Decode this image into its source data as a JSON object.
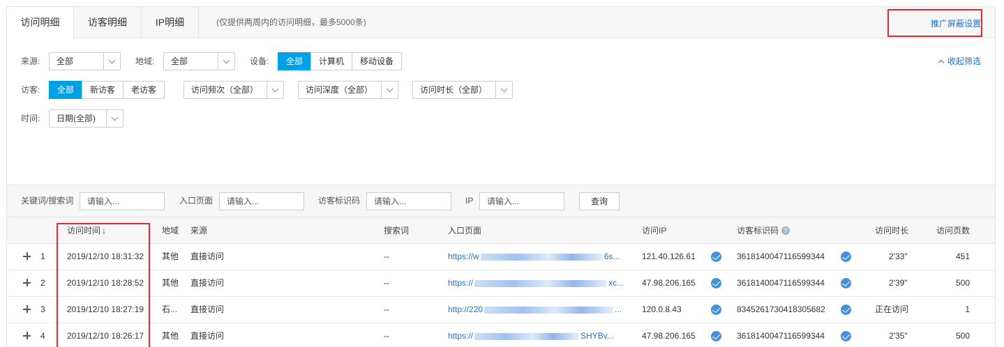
{
  "tabs": [
    {
      "label": "访问明细",
      "active": true
    },
    {
      "label": "访客明细",
      "active": false
    },
    {
      "label": "IP明细",
      "active": false
    }
  ],
  "tab_hint": "(仅提供两周内的访问明细，最多5000条)",
  "promo_link": "推广屏蔽设置",
  "collapse_label": "收起筛选",
  "filters": {
    "source": {
      "label": "来源:",
      "value": "全部"
    },
    "region": {
      "label": "地域:",
      "value": "全部"
    },
    "device": {
      "label": "设备:",
      "options": [
        "全部",
        "计算机",
        "移动设备"
      ],
      "selected": "全部"
    },
    "visitor": {
      "label": "访客:",
      "options": [
        "全部",
        "新访客",
        "老访客"
      ],
      "selected": "全部"
    },
    "frequency": {
      "value": "访问频次（全部）"
    },
    "depth": {
      "value": "访问深度（全部）"
    },
    "duration": {
      "value": "访问时长（全部）"
    },
    "time": {
      "label": "时间:",
      "value": "日期(全部)"
    }
  },
  "search": {
    "keyword_label": "关键词/搜索词",
    "entry_label": "入口页面",
    "visitor_id_label": "访客标识码",
    "ip_label": "IP",
    "placeholder": "请输入...",
    "query_button": "查询"
  },
  "table": {
    "columns": {
      "time": "访问时间",
      "region": "地域",
      "source": "来源",
      "search_term": "搜索词",
      "entry_page": "入口页面",
      "ip": "访问IP",
      "visitor_id": "访客标识码",
      "duration": "访问时长",
      "pages": "访问页数"
    },
    "rows": [
      {
        "index": "1",
        "time": "2019/12/10 18:31:32",
        "region": "其他",
        "source": "直接访问",
        "search_term": "--",
        "entry_prefix": "https://w",
        "entry_suffix": "6s...",
        "ip": "121.40.126.61",
        "visitor_id": "3618140047116599344",
        "duration": "2'33\"",
        "pages": "451"
      },
      {
        "index": "2",
        "time": "2019/12/10 18:28:52",
        "region": "其他",
        "source": "直接访问",
        "search_term": "--",
        "entry_prefix": "https://",
        "entry_suffix": "xc...",
        "ip": "47.98.206.165",
        "visitor_id": "3618140047116599344",
        "duration": "2'39\"",
        "pages": "500"
      },
      {
        "index": "3",
        "time": "2019/12/10 18:27:19",
        "region": "石...",
        "source": "直接访问",
        "search_term": "--",
        "entry_prefix": "http://220",
        "entry_suffix": "...",
        "ip": "120.0.8.43",
        "visitor_id": "8345261730418305682",
        "duration": "正在访问",
        "pages": "1"
      },
      {
        "index": "4",
        "time": "2019/12/10 18:26:17",
        "region": "其他",
        "source": "直接访问",
        "search_term": "--",
        "entry_prefix": "https://",
        "entry_suffix": "SHYBv...",
        "ip": "47.98.206.165",
        "visitor_id": "3618140047116599344",
        "duration": "2'35\"",
        "pages": "500"
      }
    ]
  },
  "colors": {
    "accent": "#00a0e9",
    "link": "#1f6fd1",
    "highlight": "#e8262d"
  }
}
